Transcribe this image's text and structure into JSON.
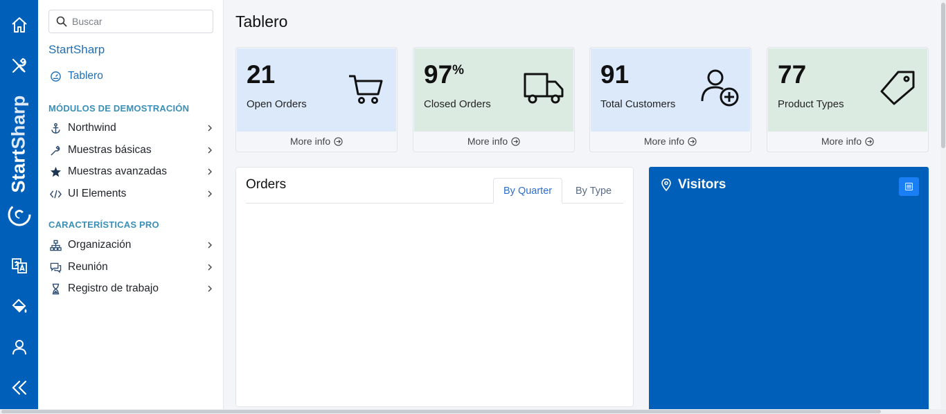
{
  "rail": {
    "brand_a": "Start",
    "brand_b": "Sharp",
    "icons": [
      "home-icon",
      "tools-icon",
      "translate-icon",
      "paint-bucket-icon",
      "user-icon",
      "collapse-icon"
    ]
  },
  "sidebar": {
    "search_placeholder": "Buscar",
    "brand": "StartSharp",
    "dashboard": "Tablero",
    "section_demo": "MÓDULOS DE DEMOSTRACIÓN",
    "demo_items": [
      {
        "label": "Northwind",
        "icon": "anchor-icon"
      },
      {
        "label": "Muestras básicas",
        "icon": "wrench-icon"
      },
      {
        "label": "Muestras avanzadas",
        "icon": "star-icon"
      },
      {
        "label": "UI Elements",
        "icon": "code-icon"
      }
    ],
    "section_pro": "CARACTERÍSTICAS PRO",
    "pro_items": [
      {
        "label": "Organización",
        "icon": "org-chart-icon"
      },
      {
        "label": "Reunión",
        "icon": "chat-icon"
      },
      {
        "label": "Registro de trabajo",
        "icon": "hourglass-icon"
      }
    ]
  },
  "main": {
    "title": "Tablero",
    "cards": [
      {
        "value": "21",
        "suffix": "",
        "label": "Open Orders",
        "more": "More info",
        "color": "#dce9fb",
        "icon": "cart-icon"
      },
      {
        "value": "97",
        "suffix": "%",
        "label": "Closed Orders",
        "more": "More info",
        "color": "#dcebe1",
        "icon": "truck-icon"
      },
      {
        "value": "91",
        "suffix": "",
        "label": "Total Customers",
        "more": "More info",
        "color": "#dce9fb",
        "icon": "user-plus-icon"
      },
      {
        "value": "77",
        "suffix": "",
        "label": "Product Types",
        "more": "More info",
        "color": "#dcebe1",
        "icon": "tag-icon"
      }
    ],
    "orders": {
      "title": "Orders",
      "tabs": [
        "By Quarter",
        "By Type"
      ],
      "active_tab": "By Quarter"
    },
    "visitors": {
      "title": "Visitors",
      "color": "#005fb8"
    }
  }
}
